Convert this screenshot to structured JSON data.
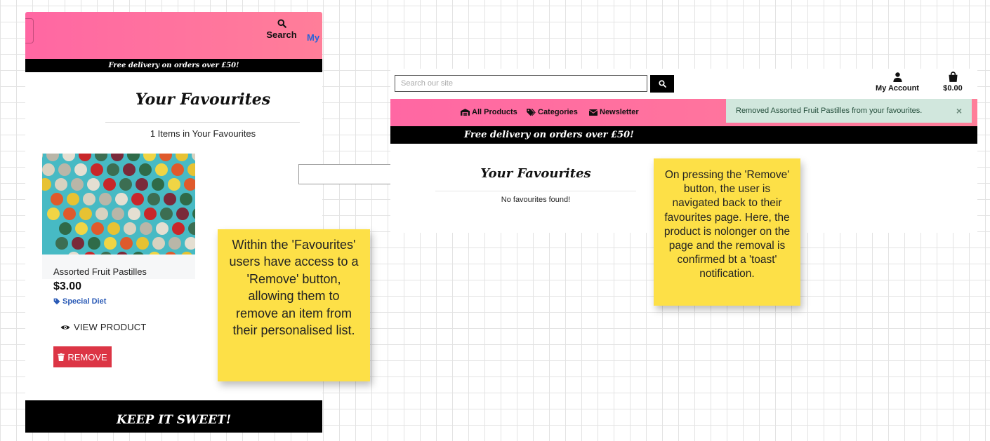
{
  "mobile": {
    "header": {
      "search_label": "Search",
      "my_label": "My"
    },
    "banner": "Free delivery on orders over £50!",
    "title": "Your Favourites",
    "count_text": "1 Items in Your Favourites",
    "product": {
      "name": "Assorted Fruit Pastilles",
      "price": "$3.00",
      "tag": "Special Diet",
      "view_label": "VIEW PRODUCT",
      "remove_label": "REMOVE"
    },
    "footer": "KEEP IT SWEET!"
  },
  "desktop": {
    "search_placeholder": "Search our site",
    "account_label": "My Account",
    "bag_total": "$0.00",
    "nav": [
      {
        "label": "All Products",
        "icon": "warehouse-icon"
      },
      {
        "label": "Categories",
        "icon": "tags-icon"
      },
      {
        "label": "Newsletter",
        "icon": "envelope-icon"
      }
    ],
    "toast": {
      "message": "Removed Assorted Fruit Pastilles from your favourites.",
      "close": "×"
    },
    "banner": "Free delivery on orders over £50!",
    "title": "Your Favourites",
    "empty_text": "No favourites found!"
  },
  "notes": {
    "left": "Within the 'Favourites' users have access to a 'Remove' button, allowing them to remove an item from their personalised list.",
    "right": "On pressing the 'Remove' button, the user is navigated back to their favourites page. Here, the product is nolonger on the page and the removal is confirmed bt a 'toast' notification."
  },
  "colors": {
    "header_pink": "#ff7099",
    "remove_red": "#dc3545",
    "toast_green": "#d1e7dd",
    "note_yellow": "#fde047",
    "tag_blue": "#2a5ab6"
  }
}
